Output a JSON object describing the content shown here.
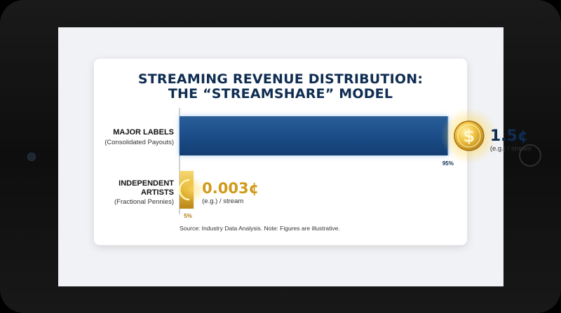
{
  "chart_data": {
    "type": "bar",
    "orientation": "horizontal",
    "title_lines": [
      "STREAMING REVENUE DISTRIBUTION:",
      "THE “STREAMSHARE” MODEL"
    ],
    "categories": [
      {
        "label": "MAJOR LABELS",
        "sublabel": "(Consolidated Payouts)"
      },
      {
        "label_lines": [
          "INDEPENDENT",
          "ARTISTS"
        ],
        "sublabel": "(Fractional Pennies)"
      }
    ],
    "values": [
      95,
      5
    ],
    "value_labels": [
      "95%",
      "5%"
    ],
    "payouts": [
      "1.5¢",
      "0.003¢"
    ],
    "payout_unit": "(e.g.) / stream",
    "xlim": [
      0,
      100
    ],
    "source": "Source: Industry Data Analysis. Note: Figures are illustrative.",
    "colors": {
      "major_bar": "#1b4d88",
      "indie_bar": "#e2b53a",
      "title": "#0f2d52",
      "major_value": "#0f2d52",
      "indie_value": "#d09a1a",
      "coin": "#e9b73a"
    },
    "icons": [
      "dollar-coin-icon",
      "partial-coin-icon"
    ]
  }
}
